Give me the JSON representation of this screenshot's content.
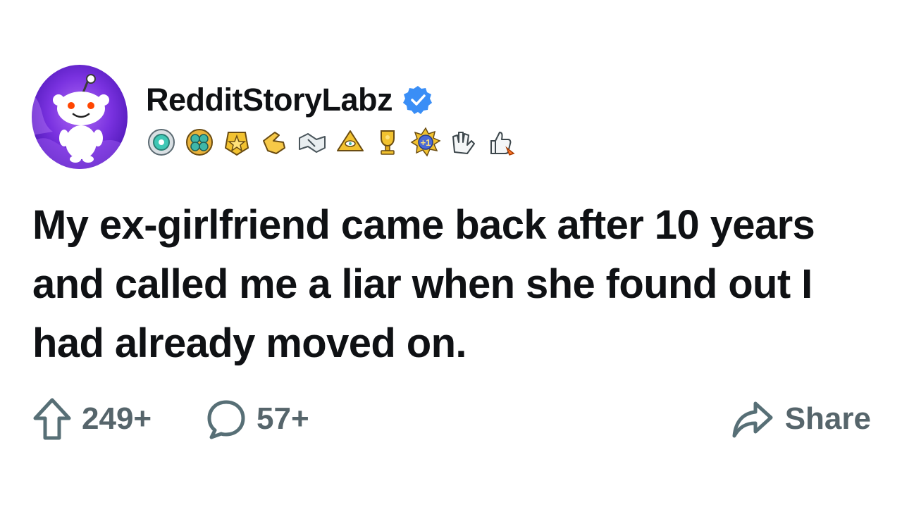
{
  "post": {
    "author": "RedditStoryLabz",
    "verified": true,
    "title": "My ex-girlfriend came back after 10 years and called me a liar when she found out I had already moved on.",
    "badges": [
      "medal-icon",
      "clover-badge-icon",
      "gold-star-badge-icon",
      "pointing-hand-icon",
      "handshake-icon",
      "pyramid-eye-icon",
      "trophy-icon",
      "plus-one-burst-icon",
      "clapping-hands-icon",
      "thumbs-up-rocket-icon"
    ]
  },
  "actions": {
    "upvotes": "249+",
    "comments": "57+",
    "share_label": "Share"
  },
  "colors": {
    "text": "#0f1114",
    "muted": "#576f76",
    "verified": "#3a8ef6",
    "avatar_bg": "#6b2ed6"
  }
}
